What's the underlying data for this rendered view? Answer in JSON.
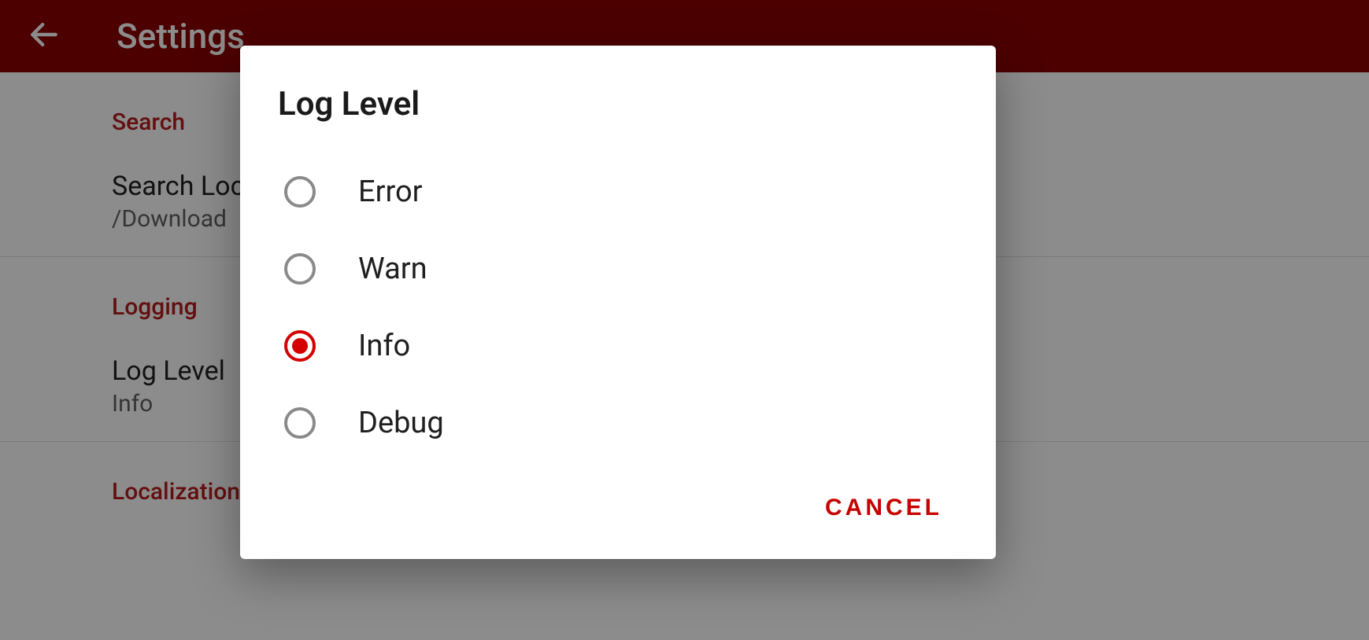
{
  "appbar": {
    "title": "Settings"
  },
  "sections": {
    "search": {
      "header": "Search",
      "pref_title": "Search Loc",
      "pref_sub": "/Download"
    },
    "logging": {
      "header": "Logging",
      "pref_title": "Log Level",
      "pref_sub": "Info"
    },
    "localization": {
      "header": "Localization"
    }
  },
  "dialog": {
    "title": "Log Level",
    "options": [
      {
        "label": "Error",
        "selected": false
      },
      {
        "label": "Warn",
        "selected": false
      },
      {
        "label": "Info",
        "selected": true
      },
      {
        "label": "Debug",
        "selected": false
      }
    ],
    "cancel_label": "CANCEL"
  },
  "colors": {
    "primary": "#8b0000",
    "accent": "#d50000"
  }
}
